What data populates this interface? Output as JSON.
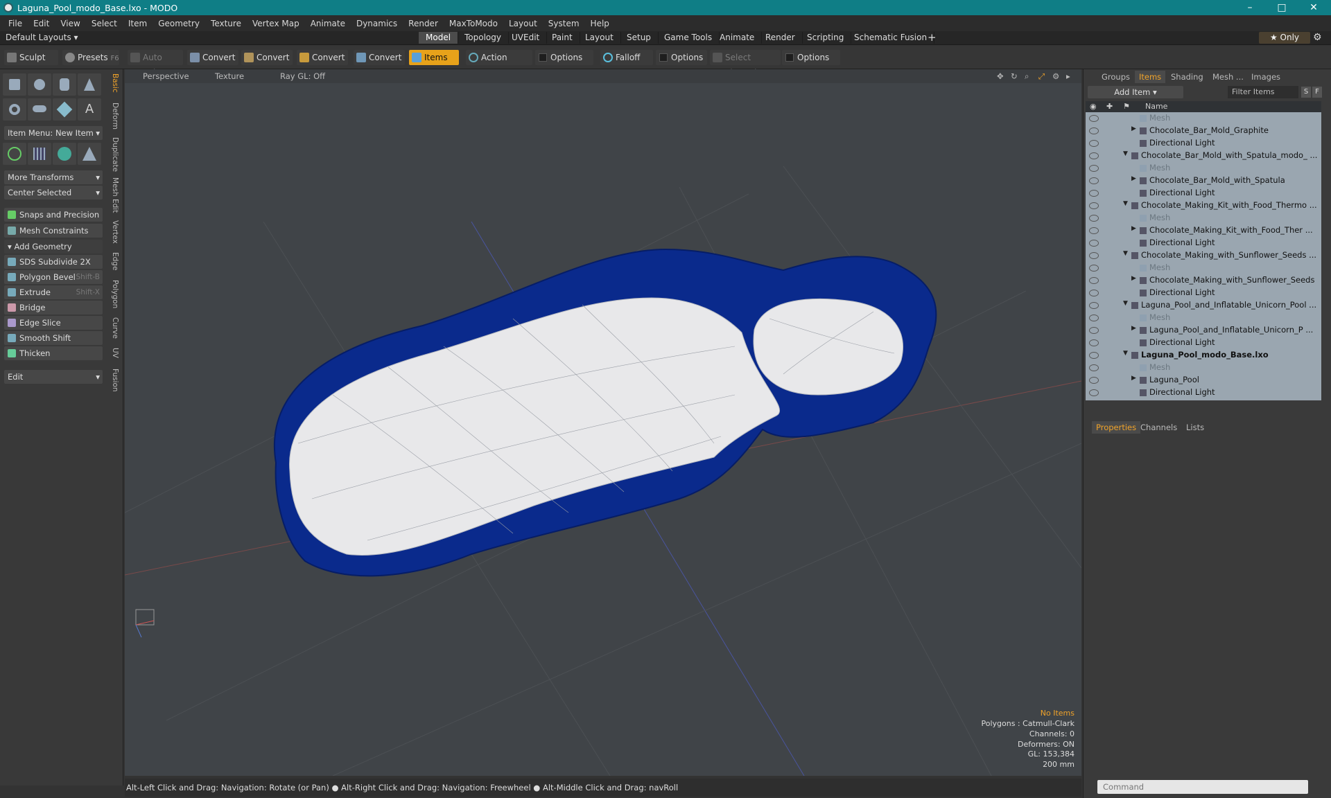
{
  "window": {
    "title": "Laguna_Pool_modo_Base.lxo - MODO",
    "minimize": "–",
    "maximize": "□",
    "close": "✕"
  },
  "menubar": {
    "items": [
      "File",
      "Edit",
      "View",
      "Select",
      "Item",
      "Geometry",
      "Texture",
      "Vertex Map",
      "Animate",
      "Dynamics",
      "Render",
      "MaxToModo",
      "Layout",
      "System",
      "Help"
    ]
  },
  "layoutbar": {
    "default_layouts": "Default Layouts ▾",
    "tabs": [
      "Model",
      "Topology",
      "UVEdit",
      "Paint",
      "Layout",
      "Setup",
      "Game Tools",
      "Animate",
      "Render",
      "Scripting",
      "Schematic Fusion"
    ],
    "active_tab": "Model",
    "add": "+",
    "only": "★  Only"
  },
  "toolbar": {
    "sculpt": "Sculpt",
    "presets": "Presets",
    "presets_key": "F6",
    "auto_select": "Auto Select",
    "convert": "Convert",
    "items": "Items",
    "action_center": "Action Center",
    "options": "Options",
    "falloff": "Falloff",
    "select_through": "Select Through"
  },
  "leftpanel": {
    "item_menu": "Item Menu: New Item",
    "more_transforms": "More Transforms",
    "center_selected": "Center Selected",
    "snaps": "Snaps and Precision",
    "mesh_constraints": "Mesh Constraints",
    "add_geometry": "Add Geometry",
    "tools": [
      {
        "label": "SDS Subdivide 2X",
        "shortcut": ""
      },
      {
        "label": "Polygon Bevel",
        "shortcut": "Shift-B"
      },
      {
        "label": "Extrude",
        "shortcut": "Shift-X"
      },
      {
        "label": "Bridge",
        "shortcut": ""
      },
      {
        "label": "Edge Slice",
        "shortcut": ""
      },
      {
        "label": "Smooth Shift",
        "shortcut": ""
      },
      {
        "label": "Thicken",
        "shortcut": ""
      }
    ],
    "edit": "Edit",
    "vtabs": [
      "Basic",
      "Deform",
      "Duplicate",
      "Mesh Edit",
      "Vertex",
      "Edge",
      "Polygon",
      "Curve",
      "UV",
      "Fusion"
    ]
  },
  "viewport": {
    "perspective": "Perspective",
    "texture": "Texture",
    "raygl": "Ray GL: Off",
    "status": {
      "no_items": "No Items",
      "polygons": "Polygons : Catmull-Clark",
      "channels": "Channels: 0",
      "deformers": "Deformers: ON",
      "gl": "GL: 153,384",
      "scale": "200 mm"
    }
  },
  "statusbar": {
    "text": "Alt-Left Click and Drag: Navigation: Rotate (or Pan) ● Alt-Right Click and Drag: Navigation: Freewheel ● Alt-Middle Click and Drag: navRoll"
  },
  "rightpanel": {
    "tabs": [
      "Groups",
      "Items",
      "Shading",
      "Mesh ...",
      "Images"
    ],
    "active_tab": "Items",
    "add_item": "Add Item",
    "filter": "Filter Items",
    "s": "S",
    "f": "F",
    "name_col": "Name",
    "rows": [
      {
        "label": "Mesh",
        "indent": 3,
        "dim": true,
        "arrow": ""
      },
      {
        "label": "Chocolate_Bar_Mold_Graphite",
        "indent": 3,
        "dim": false,
        "arrow": "▶"
      },
      {
        "label": "Directional Light",
        "indent": 3,
        "dim": false,
        "arrow": ""
      },
      {
        "label": "Chocolate_Bar_Mold_with_Spatula_modo_ ...",
        "indent": 2,
        "dim": false,
        "arrow": "▼"
      },
      {
        "label": "Mesh",
        "indent": 3,
        "dim": true,
        "arrow": ""
      },
      {
        "label": "Chocolate_Bar_Mold_with_Spatula",
        "indent": 3,
        "dim": false,
        "arrow": "▶"
      },
      {
        "label": "Directional Light",
        "indent": 3,
        "dim": false,
        "arrow": ""
      },
      {
        "label": "Chocolate_Making_Kit_with_Food_Thermo ...",
        "indent": 2,
        "dim": false,
        "arrow": "▼"
      },
      {
        "label": "Mesh",
        "indent": 3,
        "dim": true,
        "arrow": ""
      },
      {
        "label": "Chocolate_Making_Kit_with_Food_Ther ...",
        "indent": 3,
        "dim": false,
        "arrow": "▶"
      },
      {
        "label": "Directional Light",
        "indent": 3,
        "dim": false,
        "arrow": ""
      },
      {
        "label": "Chocolate_Making_with_Sunflower_Seeds ...",
        "indent": 2,
        "dim": false,
        "arrow": "▼"
      },
      {
        "label": "Mesh",
        "indent": 3,
        "dim": true,
        "arrow": ""
      },
      {
        "label": "Chocolate_Making_with_Sunflower_Seeds",
        "indent": 3,
        "dim": false,
        "arrow": "▶"
      },
      {
        "label": "Directional Light",
        "indent": 3,
        "dim": false,
        "arrow": ""
      },
      {
        "label": "Laguna_Pool_and_Inflatable_Unicorn_Pool ...",
        "indent": 2,
        "dim": false,
        "arrow": "▼"
      },
      {
        "label": "Mesh",
        "indent": 3,
        "dim": true,
        "arrow": ""
      },
      {
        "label": "Laguna_Pool_and_Inflatable_Unicorn_P ...",
        "indent": 3,
        "dim": false,
        "arrow": "▶"
      },
      {
        "label": "Directional Light",
        "indent": 3,
        "dim": false,
        "arrow": ""
      },
      {
        "label": "Laguna_Pool_modo_Base.lxo",
        "indent": 2,
        "dim": false,
        "arrow": "▼",
        "bold": true
      },
      {
        "label": "Mesh",
        "indent": 3,
        "dim": true,
        "arrow": ""
      },
      {
        "label": "Laguna_Pool",
        "indent": 3,
        "dim": false,
        "arrow": "▶"
      },
      {
        "label": "Directional Light",
        "indent": 3,
        "dim": false,
        "arrow": ""
      }
    ],
    "bottom_tabs": [
      "Properties",
      "Channels",
      "Lists"
    ],
    "bottom_active": "Properties",
    "command_placeholder": "Command"
  },
  "colors": {
    "accent": "#e7a21a",
    "titlebar": "#0f7e86",
    "pool_blue": "#0a2a8c"
  }
}
